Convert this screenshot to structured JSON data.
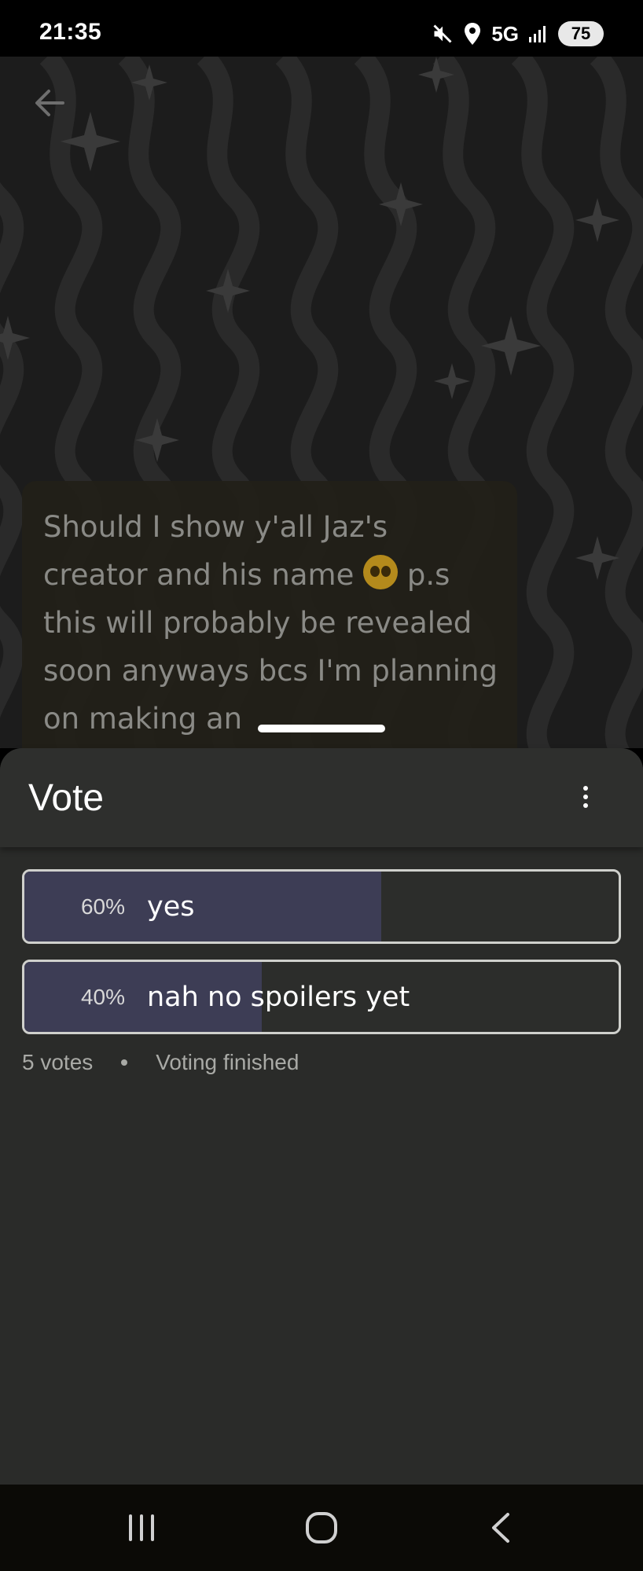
{
  "status_bar": {
    "time": "21:35",
    "network": "5G",
    "battery": "75",
    "icons": [
      "mute-icon",
      "location-icon",
      "signal-icon",
      "battery-icon"
    ]
  },
  "post": {
    "text_before_emoji": "Should I show y'all Jaz's creator and his name ",
    "text_after_emoji": " p.s this will probably be revealed soon anyways bcs I'm planning on making an"
  },
  "sheet": {
    "title": "Vote",
    "options": [
      {
        "percent_label": "60%",
        "label": "yes",
        "share": 0.6
      },
      {
        "percent_label": "40%",
        "label": "nah no spoilers yet",
        "share": 0.4
      }
    ],
    "votes": "5 votes",
    "state": "Voting finished"
  },
  "colors": {
    "sheet_bg": "#2a2b29",
    "vote_fill": "#3d3d55",
    "option_border": "#cfd0cc",
    "muted_text": "#a9aaa6"
  }
}
